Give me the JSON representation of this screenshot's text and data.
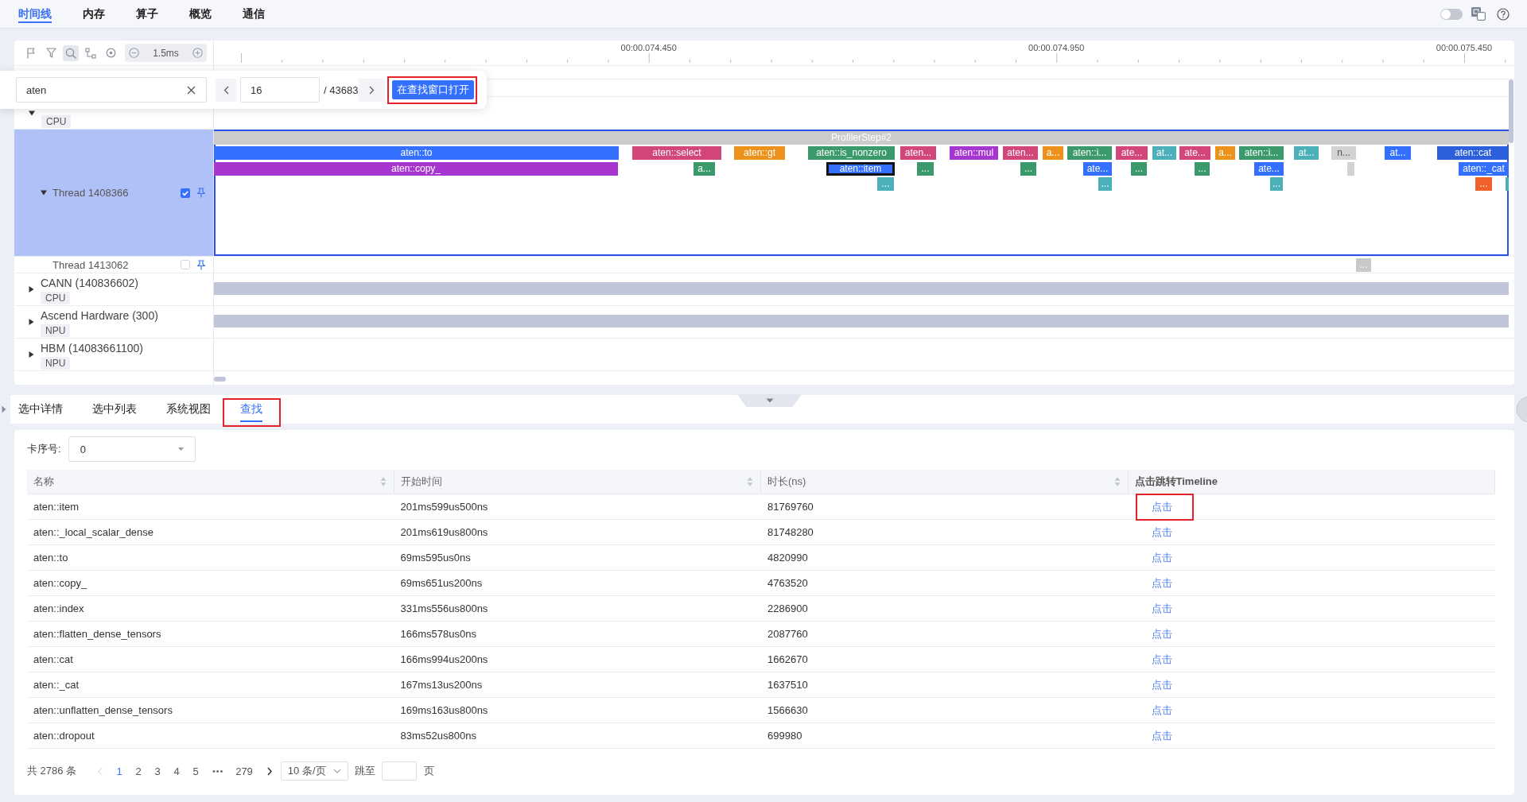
{
  "top_tabs": [
    {
      "label": "时间线",
      "selected": true
    },
    {
      "label": "内存",
      "selected": false
    },
    {
      "label": "算子",
      "selected": false
    },
    {
      "label": "概览",
      "selected": false
    },
    {
      "label": "通信",
      "selected": false
    }
  ],
  "top_right": {
    "theme_switch_on": false
  },
  "timeline": {
    "tools": [
      {
        "selected": false
      },
      {
        "selected": false
      },
      {
        "selected": true
      },
      {
        "selected": false
      },
      {
        "selected": false
      }
    ],
    "zoom_value": "1.5ms",
    "ruler_labels": [
      "00:00.074.450",
      "00:00.074.950",
      "00:00.075.450"
    ],
    "search": {
      "value": "aten",
      "current": "16",
      "total": "/ 43683",
      "open_button": {
        "label": "在查找窗口打开",
        "highlighted": true
      }
    },
    "tracks": [
      {
        "kind": "process",
        "tag": "CPU",
        "expanded": true,
        "summary_bar": false
      },
      {
        "kind": "thread",
        "name": "Thread 1408366",
        "expanded": true,
        "checked": true,
        "selected": true,
        "lanes": [
          [
            {
              "label": "ProfilerStep#2",
              "color": "#cccccc",
              "selected": false
            }
          ],
          [
            {
              "label": "aten::to",
              "color": "#3370ff",
              "selected": false
            },
            {
              "label": "aten::select",
              "color": "#d3467a",
              "selected": false
            },
            {
              "label": "aten::gt",
              "color": "#ec921a",
              "selected": false
            },
            {
              "label": "aten::is_nonzero",
              "color": "#3a9a6c",
              "selected": false
            },
            {
              "label": "aten...",
              "color": "#d3467a",
              "selected": false
            },
            {
              "label": "aten::mul",
              "color": "#a636cf",
              "selected": false
            },
            {
              "label": "aten...",
              "color": "#d3467a",
              "selected": false
            },
            {
              "label": "a...",
              "color": "#ec921a",
              "selected": false
            },
            {
              "label": "aten::i...",
              "color": "#3a9a6c",
              "selected": false
            },
            {
              "label": "ate...",
              "color": "#d3467a",
              "selected": false
            },
            {
              "label": "at...",
              "color": "#4bb0b9",
              "selected": false
            },
            {
              "label": "ate...",
              "color": "#d3467a",
              "selected": false
            },
            {
              "label": "a...",
              "color": "#ec921a",
              "selected": false
            },
            {
              "label": "aten::i...",
              "color": "#3a9a6c",
              "selected": false
            },
            {
              "label": "at...",
              "color": "#4bb0b9",
              "selected": false
            },
            {
              "label": "n...",
              "color": "#d2d2d2",
              "selected": false
            },
            {
              "label": "at...",
              "color": "#3370ff",
              "selected": false
            },
            {
              "label": "aten::cat",
              "color": "#2b5fdc",
              "selected": false
            }
          ],
          [
            {
              "label": "aten::copy_",
              "color": "#a636cf",
              "selected": false
            },
            {
              "label": "a...",
              "color": "#3a9a6c",
              "selected": false
            },
            {
              "label": "aten::item",
              "color": "#3370ff",
              "selected": true
            },
            {
              "label": "...",
              "color": "#3a9a6c",
              "selected": false
            },
            {
              "label": "...",
              "color": "#3a9a6c",
              "selected": false
            },
            {
              "label": "ate...",
              "color": "#3370ff",
              "selected": false
            },
            {
              "label": "...",
              "color": "#3a9a6c",
              "selected": false
            },
            {
              "label": "...",
              "color": "#3a9a6c",
              "selected": false
            },
            {
              "label": "ate...",
              "color": "#3370ff",
              "selected": false
            },
            {
              "color": "#d2d2d2",
              "selected": false
            },
            {
              "label": "aten::_cat",
              "color": "#3370ff",
              "selected": false
            }
          ],
          [
            {
              "label": "...",
              "color": "#4bb0b9",
              "selected": false
            },
            {
              "label": "...",
              "color": "#4bb0b9",
              "selected": false
            },
            {
              "label": "...",
              "color": "#4bb0b9",
              "selected": false
            },
            {
              "label": "...",
              "color": "#f0602a",
              "selected": false
            },
            {
              "color": "#4bb0b9",
              "selected": false
            }
          ]
        ]
      },
      {
        "kind": "thread",
        "name": "Thread 1413062",
        "checked": false,
        "selected": false,
        "lanes": [
          [
            {
              "label": "...",
              "color": "#c9c9c9",
              "selected": false
            }
          ]
        ]
      },
      {
        "kind": "process",
        "name": "CANN (140836602)",
        "tag": "CPU",
        "expanded": false,
        "summary_bar": true
      },
      {
        "kind": "process",
        "name": "Ascend Hardware (300)",
        "tag": "NPU",
        "expanded": false,
        "summary_bar": true
      },
      {
        "kind": "process",
        "name": "HBM (14083661100)",
        "tag": "NPU",
        "expanded": false,
        "summary_bar": false
      }
    ]
  },
  "bottom_panel": {
    "tabs": [
      {
        "label": "选中详情",
        "selected": false,
        "highlighted": false
      },
      {
        "label": "选中列表",
        "selected": false,
        "highlighted": false
      },
      {
        "label": "系统视图",
        "selected": false,
        "highlighted": false
      },
      {
        "label": "查找",
        "selected": true,
        "highlighted": true
      }
    ],
    "card_label": "卡序号:",
    "card_value": "0",
    "table": {
      "columns": [
        {
          "label": "名称",
          "sortable": true
        },
        {
          "label": "开始时间",
          "sortable": true
        },
        {
          "label": "时长(ns)",
          "sortable": true
        },
        {
          "label": "点击跳转Timeline",
          "sortable": false
        }
      ],
      "rows": [
        {
          "name": "aten::item",
          "start": "201ms599us500ns",
          "duration": "81769760",
          "link": "点击",
          "highlighted": true
        },
        {
          "name": "aten::_local_scalar_dense",
          "start": "201ms619us800ns",
          "duration": "81748280",
          "link": "点击",
          "highlighted": false
        },
        {
          "name": "aten::to",
          "start": "69ms595us0ns",
          "duration": "4820990",
          "link": "点击",
          "highlighted": false
        },
        {
          "name": "aten::copy_",
          "start": "69ms651us200ns",
          "duration": "4763520",
          "link": "点击",
          "highlighted": false
        },
        {
          "name": "aten::index",
          "start": "331ms556us800ns",
          "duration": "2286900",
          "link": "点击",
          "highlighted": false
        },
        {
          "name": "aten::flatten_dense_tensors",
          "start": "166ms578us0ns",
          "duration": "2087760",
          "link": "点击",
          "highlighted": false
        },
        {
          "name": "aten::cat",
          "start": "166ms994us200ns",
          "duration": "1662670",
          "link": "点击",
          "highlighted": false
        },
        {
          "name": "aten::_cat",
          "start": "167ms13us200ns",
          "duration": "1637510",
          "link": "点击",
          "highlighted": false
        },
        {
          "name": "aten::unflatten_dense_tensors",
          "start": "169ms163us800ns",
          "duration": "1566630",
          "link": "点击",
          "highlighted": false
        },
        {
          "name": "aten::dropout",
          "start": "83ms52us800ns",
          "duration": "699980",
          "link": "点击",
          "highlighted": false
        }
      ]
    },
    "pagination": {
      "total": "共 2786 条",
      "items": [
        {
          "kind": "prev",
          "disabled": true
        },
        {
          "kind": "page",
          "label": "1",
          "selected": true
        },
        {
          "kind": "page",
          "label": "2",
          "selected": false
        },
        {
          "kind": "page",
          "label": "3",
          "selected": false
        },
        {
          "kind": "page",
          "label": "4",
          "selected": false
        },
        {
          "kind": "page",
          "label": "5",
          "selected": false
        },
        {
          "kind": "more",
          "label": "•••"
        },
        {
          "kind": "page",
          "label": "279",
          "selected": false
        },
        {
          "kind": "next",
          "disabled": false
        }
      ],
      "page_size": "10 条/页",
      "jump_label": "跳至",
      "jump_suffix": "页"
    }
  }
}
